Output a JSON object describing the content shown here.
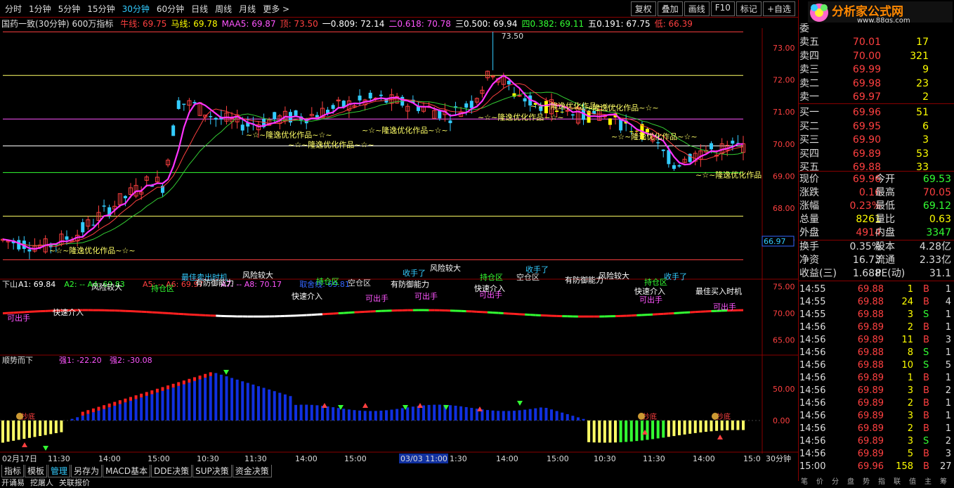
{
  "toolbar": {
    "periods": [
      "分时",
      "1分钟",
      "5分钟",
      "15分钟",
      "30分钟",
      "60分钟",
      "日线",
      "周线",
      "月线",
      "更多 >"
    ],
    "active_period": "30分钟",
    "right_buttons": [
      "复权",
      "叠加",
      "画线",
      "F10",
      "标记",
      "+自选"
    ]
  },
  "info_line": {
    "title": "国药一致(30分钟) 600万指标",
    "items": [
      {
        "text": "牛线: 69.75",
        "color": "#ff4040"
      },
      {
        "text": "马线: 69.78",
        "color": "#ffff00"
      },
      {
        "text": "MAA5: 69.87",
        "color": "#ff55ff"
      },
      {
        "text": "顶: 73.50",
        "color": "#ff4040"
      },
      {
        "text": "一0.809: 72.14",
        "color": "#ffffff"
      },
      {
        "text": "二0.618: 70.78",
        "color": "#ff55ff"
      },
      {
        "text": "三0.500: 69.94",
        "color": "#ffffff"
      },
      {
        "text": "四0.382: 69.11",
        "color": "#33ff33"
      },
      {
        "text": "五0.191: 67.75",
        "color": "#ffffff"
      },
      {
        "text": "低: 66.39",
        "color": "#ff4040"
      }
    ]
  },
  "main_chart": {
    "y_ticks": [
      "73.00",
      "72.00",
      "71.00",
      "70.00",
      "69.00",
      "68.00",
      "67.00"
    ],
    "current_price_tag": "66.97",
    "peak_label": "73.50",
    "low_label": "66.39",
    "watermark": "~☆~隆逸优化作品~☆~",
    "watermark_short": "~☆~隆逸优化作品"
  },
  "indicator1": {
    "title": "下山",
    "values": [
      {
        "text": "A1: 69.84",
        "color": "#ffffff"
      },
      {
        "text": "A2: -- A4: 69.83",
        "color": "#33ff33"
      },
      {
        "text": "A5: -- A6: 69.97",
        "color": "#ff4040"
      },
      {
        "text": "A7: -- A8: 70.17",
        "color": "#ff55ff"
      },
      {
        "text": "取舍线: 69.81",
        "color": "#3366ff"
      }
    ],
    "y_ticks": [
      "75.00",
      "70.00",
      "65.00"
    ],
    "labels": [
      "风险较大",
      "持仓区",
      "最佳卖出时机",
      "有防御能力",
      "风险较大",
      "快速介入",
      "持仓区",
      "空仓区",
      "可出手",
      "有防御能力",
      "收手了",
      "风险较大",
      "可出手",
      "快速介入",
      "持仓区",
      "空仓区",
      "收手了",
      "可出手",
      "有防御能力",
      "风险较大",
      "快速介入",
      "持仓区",
      "可出手",
      "收手了",
      "最佳买入时机",
      "可出手",
      "可出手",
      "快速介入"
    ]
  },
  "indicator2": {
    "title": "顺势而下",
    "values": [
      {
        "text": "强1: -22.20",
        "color": "#ff55ff"
      },
      {
        "text": "强2: -30.08",
        "color": "#ff55ff"
      }
    ],
    "y_ticks": [
      "50.00",
      "0.00"
    ],
    "bottom_label": "抄底"
  },
  "time_axis": {
    "labels": [
      "02月17日",
      "11:30",
      "14:00",
      "15:00",
      "10:30",
      "11:30",
      "14:00",
      "15:00",
      "03/03 11:00",
      "1:30",
      "14:00",
      "15:00",
      "10:30",
      "11:30",
      "14:00",
      "15:0"
    ],
    "period_tag": "30分钟"
  },
  "bottom_tabs": [
    "指标",
    "模板",
    "管理",
    "另存为",
    "MACD基本",
    "DDE决策",
    "SUP决策",
    "资金决策"
  ],
  "bottom_active": "管理",
  "bottom_row2": [
    "开诵易",
    "挖屠人",
    "关联报价"
  ],
  "right_panel": {
    "logo_text": "分析家公式网",
    "logo_url": "www.88gs.com",
    "code_label": "委",
    "sell": [
      {
        "label": "卖五",
        "price": "70.01",
        "vol": "17"
      },
      {
        "label": "卖四",
        "price": "70.00",
        "vol": "321"
      },
      {
        "label": "卖三",
        "price": "69.99",
        "vol": "9"
      },
      {
        "label": "卖二",
        "price": "69.98",
        "vol": "23"
      },
      {
        "label": "卖一",
        "price": "69.97",
        "vol": "2"
      }
    ],
    "buy": [
      {
        "label": "买一",
        "price": "69.96",
        "vol": "51"
      },
      {
        "label": "买二",
        "price": "69.95",
        "vol": "6"
      },
      {
        "label": "买三",
        "price": "69.90",
        "vol": "3"
      },
      {
        "label": "买四",
        "price": "69.89",
        "vol": "53"
      },
      {
        "label": "买五",
        "price": "69.88",
        "vol": "33"
      }
    ],
    "stats": [
      {
        "l1": "现价",
        "v1": "69.96",
        "c1": "#ff4040",
        "l2": "今开",
        "v2": "69.53",
        "c2": "#33ff33"
      },
      {
        "l1": "涨跌",
        "v1": "0.16",
        "c1": "#ff4040",
        "l2": "最高",
        "v2": "70.05",
        "c2": "#ff4040"
      },
      {
        "l1": "涨幅",
        "v1": "0.23%",
        "c1": "#ff4040",
        "l2": "最低",
        "v2": "69.12",
        "c2": "#33ff33"
      },
      {
        "l1": "总量",
        "v1": "8261",
        "c1": "#ffff00",
        "l2": "量比",
        "v2": "0.63",
        "c2": "#ffff00"
      },
      {
        "l1": "外盘",
        "v1": "4914",
        "c1": "#ff4040",
        "l2": "内盘",
        "v2": "3347",
        "c2": "#33ff33"
      },
      {
        "l1": "换手",
        "v1": "0.35%",
        "c1": "#dddddd",
        "l2": "股本",
        "v2": "4.28亿",
        "c2": "#dddddd"
      },
      {
        "l1": "净资",
        "v1": "16.73",
        "c1": "#dddddd",
        "l2": "流通",
        "v2": "2.33亿",
        "c2": "#dddddd"
      },
      {
        "l1": "收益(三)",
        "v1": "1.688",
        "c1": "#dddddd",
        "l2": "PE(动)",
        "v2": "31.1",
        "c2": "#dddddd"
      }
    ],
    "ticks": [
      {
        "t": "14:55",
        "p": "69.88",
        "v": "1",
        "bs": "B",
        "n": "1"
      },
      {
        "t": "14:55",
        "p": "69.88",
        "v": "24",
        "bs": "B",
        "n": "4"
      },
      {
        "t": "14:55",
        "p": "69.88",
        "v": "3",
        "bs": "S",
        "n": "1"
      },
      {
        "t": "14:56",
        "p": "69.89",
        "v": "2",
        "bs": "B",
        "n": "1"
      },
      {
        "t": "14:56",
        "p": "69.89",
        "v": "11",
        "bs": "B",
        "n": "3"
      },
      {
        "t": "14:56",
        "p": "69.88",
        "v": "8",
        "bs": "S",
        "n": "1"
      },
      {
        "t": "14:56",
        "p": "69.88",
        "v": "10",
        "bs": "S",
        "n": "5"
      },
      {
        "t": "14:56",
        "p": "69.89",
        "v": "1",
        "bs": "B",
        "n": "1"
      },
      {
        "t": "14:56",
        "p": "69.89",
        "v": "3",
        "bs": "B",
        "n": "2"
      },
      {
        "t": "14:56",
        "p": "69.89",
        "v": "2",
        "bs": "B",
        "n": "1"
      },
      {
        "t": "14:56",
        "p": "69.89",
        "v": "3",
        "bs": "B",
        "n": "1"
      },
      {
        "t": "14:56",
        "p": "69.89",
        "v": "2",
        "bs": "B",
        "n": "1"
      },
      {
        "t": "14:56",
        "p": "69.89",
        "v": "3",
        "bs": "S",
        "n": "2"
      },
      {
        "t": "14:56",
        "p": "69.89",
        "v": "5",
        "bs": "B",
        "n": "3"
      },
      {
        "t": "15:00",
        "p": "69.96",
        "v": "158",
        "bs": "B",
        "n": "27"
      }
    ],
    "bottom_labels": [
      "笔",
      "价",
      "分",
      "盘",
      "势",
      "指",
      "联",
      "值",
      "主",
      "筹"
    ]
  },
  "colors": {
    "up": "#ff4040",
    "down": "#33ccff",
    "yellow": "#ffff00",
    "magenta": "#ff55ff",
    "green": "#33ff33",
    "blue": "#1020e0",
    "frame": "#800000"
  }
}
